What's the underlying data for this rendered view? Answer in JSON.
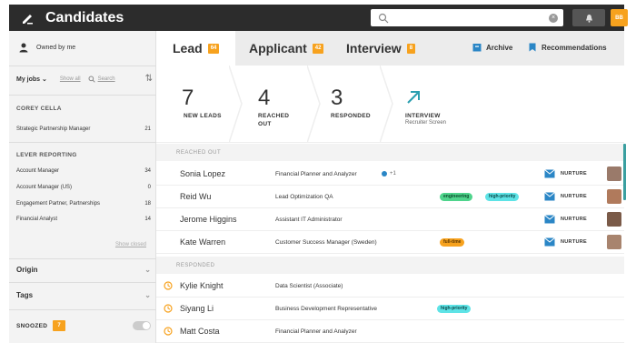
{
  "header": {
    "title": "Candidates",
    "search_placeholder": "",
    "avatar_initials": "BB"
  },
  "sidebar": {
    "owned_by": "Owned by me",
    "my_jobs": "My jobs",
    "show_all": "Show all",
    "search": "Search",
    "sections": [
      {
        "heading": "COREY CELLA",
        "items": [
          {
            "label": "Strategic Partnership Manager",
            "count": "21"
          }
        ]
      },
      {
        "heading": "LEVER REPORTING",
        "items": [
          {
            "label": "Account Manager",
            "count": "34"
          },
          {
            "label": "Account Manager (US)",
            "count": "0"
          },
          {
            "label": "Engagement Partner, Partnerships",
            "count": "18"
          },
          {
            "label": "Financial Analyst",
            "count": "14"
          }
        ]
      }
    ],
    "show_closed": "Show closed",
    "origin": "Origin",
    "tags": "Tags",
    "snoozed": "SNOOZED",
    "snoozed_count": "7"
  },
  "tabs": [
    {
      "label": "Lead",
      "count": "64"
    },
    {
      "label": "Applicant",
      "count": "42"
    },
    {
      "label": "Interview",
      "count": "8"
    }
  ],
  "links": {
    "archive": "Archive",
    "recommendations": "Recommendations"
  },
  "stages": [
    {
      "num": "7",
      "label": "NEW LEADS",
      "sub": ""
    },
    {
      "num": "4",
      "label": "REACHED OUT",
      "sub": ""
    },
    {
      "num": "3",
      "label": "RESPONDED",
      "sub": ""
    },
    {
      "num": "",
      "label": "INTERVIEW",
      "sub": "Recruiter Screen"
    }
  ],
  "groups": {
    "reached_out": "REACHED OUT",
    "responded": "RESPONDED"
  },
  "reached_rows": [
    {
      "name": "Sonia Lopez",
      "title": "Financial Planner and Analyzer",
      "extra": "+1",
      "tags": [],
      "status": "NURTURE",
      "pic": "#9a7a6a"
    },
    {
      "name": "Reid Wu",
      "title": "Lead Optimization QA",
      "extra": "",
      "tags": [
        {
          "label": "engineering",
          "color": "green"
        },
        {
          "label": "high-priority",
          "color": "cyan"
        }
      ],
      "status": "NURTURE",
      "pic": "#b07a5c"
    },
    {
      "name": "Jerome Higgins",
      "title": "Assistant IT Administrator",
      "extra": "",
      "tags": [],
      "status": "NURTURE",
      "pic": "#7a5a48"
    },
    {
      "name": "Kate Warren",
      "title": "Customer Success Manager (Sweden)",
      "extra": "",
      "tags": [
        {
          "label": "full-time",
          "color": "orange"
        }
      ],
      "status": "NURTURE",
      "pic": "#a8846e"
    }
  ],
  "responded_rows": [
    {
      "name": "Kylie Knight",
      "title": "Data Scientist (Associate)",
      "tags": []
    },
    {
      "name": "Siyang Li",
      "title": "Business Development Representative",
      "tags": [
        {
          "label": "high-priority",
          "color": "cyan"
        }
      ]
    },
    {
      "name": "Matt Costa",
      "title": "Financial Planner and Analyzer",
      "tags": []
    }
  ],
  "colors": {
    "accent": "#f7a21e",
    "topbar": "#2c2c2c",
    "link_blue": "#2a86c6",
    "teal": "#2a9fb0"
  }
}
